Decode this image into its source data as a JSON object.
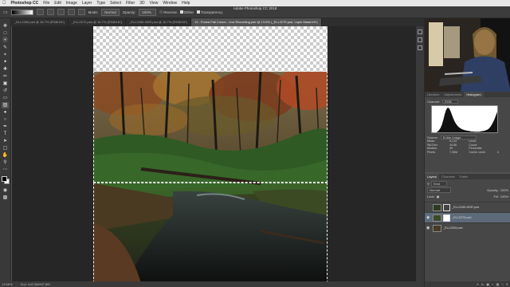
{
  "menubar": {
    "app": "Photoshop CC",
    "items": [
      "File",
      "Edit",
      "Image",
      "Layer",
      "Type",
      "Select",
      "Filter",
      "3D",
      "View",
      "Window",
      "Help"
    ]
  },
  "window": {
    "title": "Adobe Photoshop CC 2018"
  },
  "options": {
    "mode_label": "Mode:",
    "mode": "Normal",
    "opacity_label": "Opacity:",
    "opacity": "100%",
    "reverse": "Reverse",
    "dither": "Dither",
    "transparency": "Transparency"
  },
  "tabs": [
    "_ELL2269.psd @ 16.7% (RGB/16*)",
    "_ELL2272.psd @ 16.7% (RGB/16*)",
    "_ELL2265-HDR.psd @ 16.7% (RGB/16*)",
    "13 - Forest Fall Colors - Live Recording.psb @ 13.6% (_ELL2275.psd, Layer Mask/16*)"
  ],
  "status": {
    "zoom": "13.65%",
    "doc": "Doc: 418.3M/697.8M"
  },
  "panels": {
    "histogram_tabs": [
      "Libraries",
      "Adjustments",
      "Histogram"
    ],
    "channel_label": "Channel:",
    "channel": "RGB",
    "source_label": "Source:",
    "source": "Entire Image",
    "stats": [
      "Mean:",
      "61.34",
      "Level:",
      "",
      "Std Dev:",
      "44.86",
      "Count:",
      "",
      "Median:",
      "49",
      "Percentile:",
      "",
      "Pixels:",
      "7.36M",
      "Cache Level:",
      "4"
    ],
    "layers_tabs": [
      "Layers",
      "Channels",
      "Paths"
    ],
    "kind": "Kind",
    "blend": "Normal",
    "opacity_label": "Opacity:",
    "opacity": "100%",
    "lock_label": "Lock:",
    "fill_label": "Fill:",
    "fill": "100%",
    "layers": [
      {
        "name": "_ELL2265-HDR.psd",
        "visible": false,
        "selected": false
      },
      {
        "name": "_ELL2275.psd",
        "visible": true,
        "selected": true
      },
      {
        "name": "_ELL2269.psd",
        "visible": true,
        "selected": false
      }
    ]
  },
  "histogram": {
    "values": [
      2,
      3,
      4,
      6,
      9,
      14,
      22,
      34,
      52,
      74,
      90,
      98,
      96,
      86,
      72,
      58,
      46,
      37,
      30,
      25,
      21,
      18,
      16,
      14,
      13,
      12,
      11,
      10,
      9,
      9,
      8,
      8,
      8,
      8,
      9,
      10,
      11,
      12,
      14,
      16,
      20,
      26,
      34,
      44,
      56,
      70,
      84,
      96
    ]
  }
}
